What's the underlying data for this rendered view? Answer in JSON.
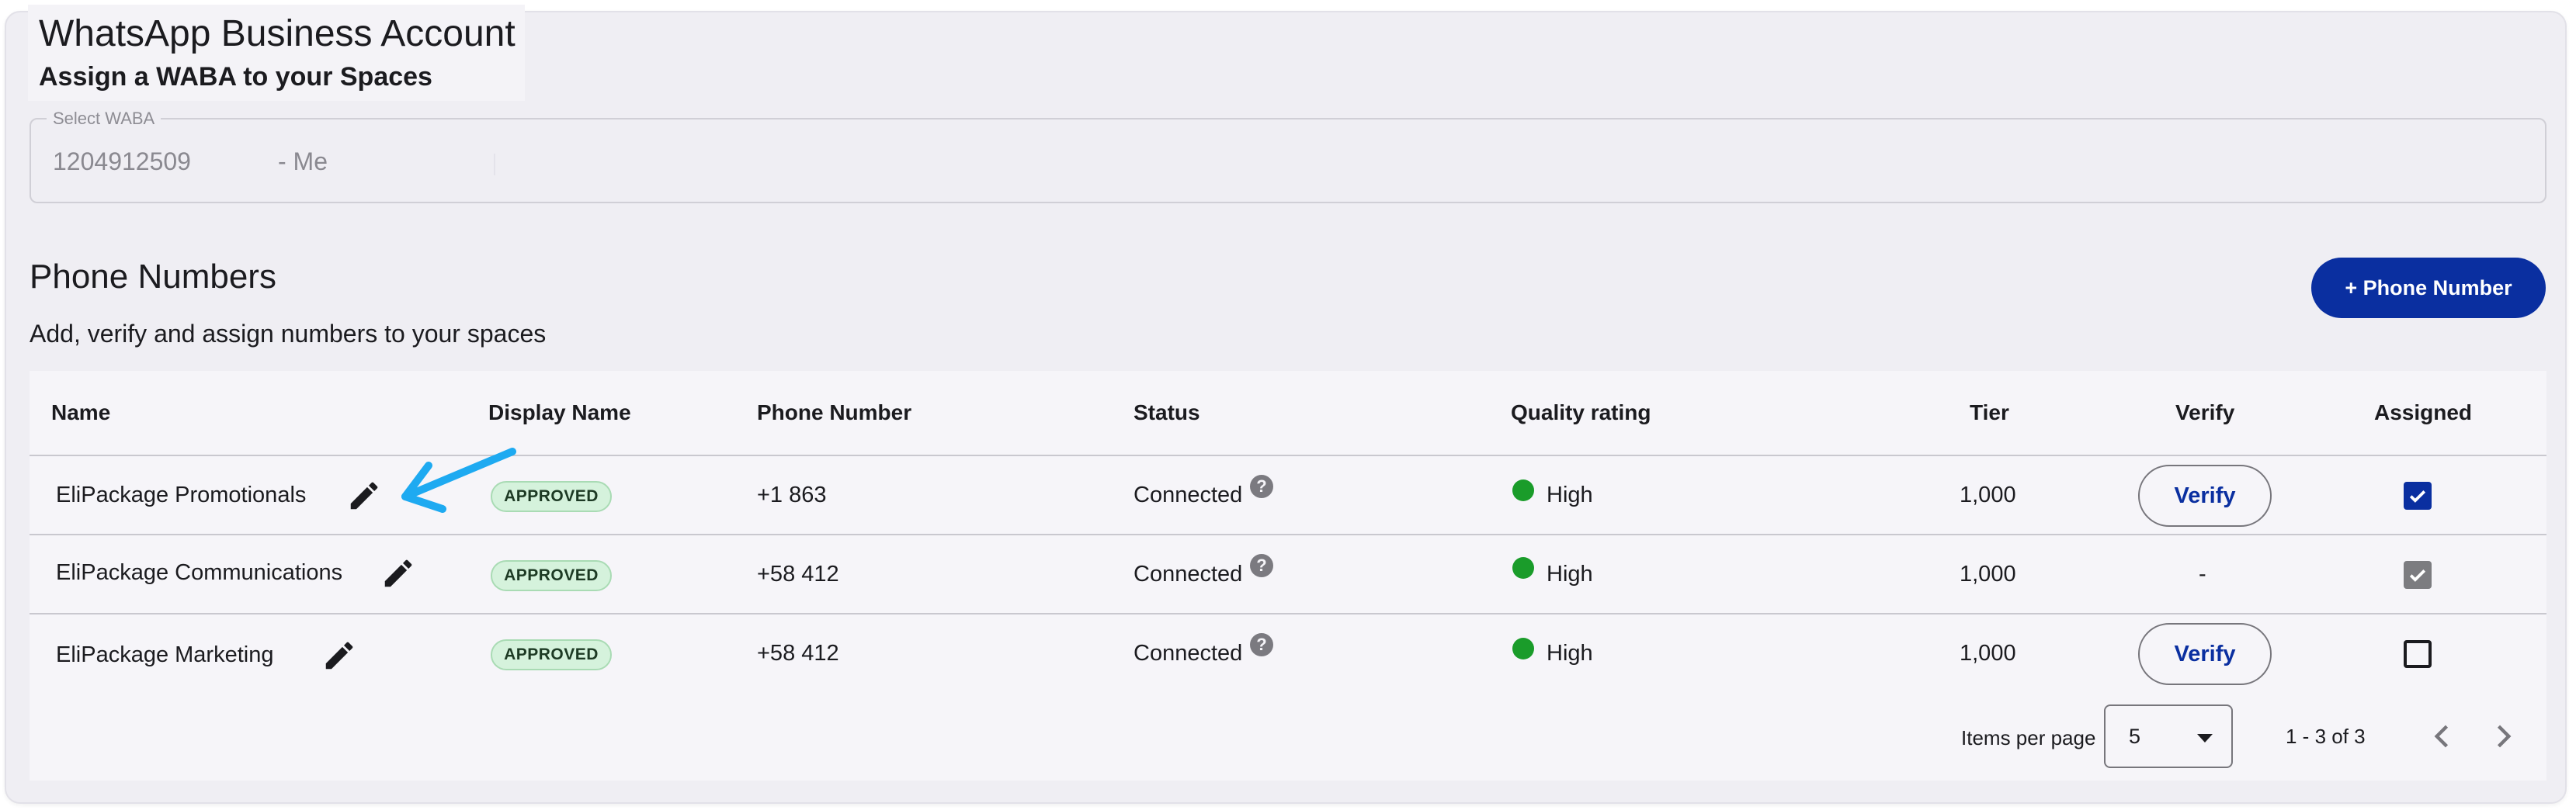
{
  "header": {
    "title": "WhatsApp Business Account",
    "subtitle": "Assign a WABA to your Spaces"
  },
  "waba_select": {
    "label": "Select WABA",
    "id": "1204912509",
    "owner": "- Me"
  },
  "phone_section": {
    "title": "Phone Numbers",
    "subtitle": "Add, verify and assign numbers to your spaces",
    "add_button": "+ Phone Number"
  },
  "table": {
    "columns": [
      "Name",
      "Display Name",
      "Phone Number",
      "Status",
      "Quality rating",
      "Tier",
      "Verify",
      "Assigned"
    ],
    "rows": [
      {
        "name": "EliPackage Promotionals",
        "display_status": "APPROVED",
        "phone": "+1 863",
        "status": "Connected",
        "quality": "High",
        "tier": "1,000",
        "verify": "Verify",
        "assigned": "checked"
      },
      {
        "name": "EliPackage Communications",
        "display_status": "APPROVED",
        "phone": "+58 412",
        "status": "Connected",
        "quality": "High",
        "tier": "1,000",
        "verify": "-",
        "assigned": "checked-disabled"
      },
      {
        "name": "EliPackage Marketing",
        "display_status": "APPROVED",
        "phone": "+58 412",
        "status": "Connected",
        "quality": "High",
        "tier": "1,000",
        "verify": "Verify",
        "assigned": "unchecked"
      }
    ]
  },
  "pagination": {
    "items_per_page_label": "Items per page",
    "items_per_page": "5",
    "range": "1 - 3 of 3"
  },
  "icons": {
    "help": "?"
  },
  "colors": {
    "primary": "#0a2fa0",
    "quality_high": "#1a9c2a",
    "badge_bg": "#d5f2dc",
    "annotation_arrow": "#1eaaf1"
  }
}
